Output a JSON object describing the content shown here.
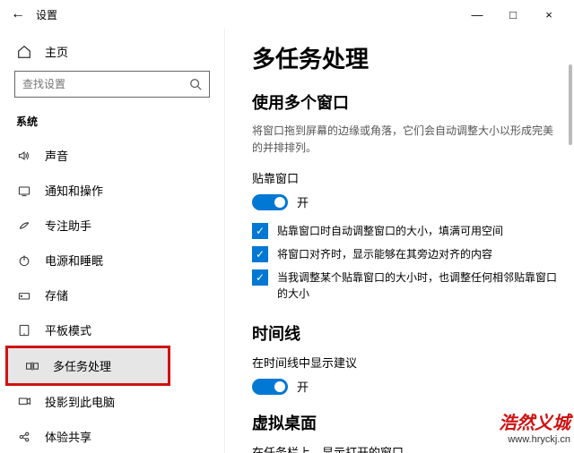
{
  "window": {
    "title": "设置",
    "min": "—",
    "max": "□",
    "close": "×"
  },
  "sidebar": {
    "home": "主页",
    "search_placeholder": "查找设置",
    "category": "系统",
    "items": [
      {
        "label": "声音"
      },
      {
        "label": "通知和操作"
      },
      {
        "label": "专注助手"
      },
      {
        "label": "电源和睡眠"
      },
      {
        "label": "存储"
      },
      {
        "label": "平板模式"
      },
      {
        "label": "多任务处理"
      },
      {
        "label": "投影到此电脑"
      },
      {
        "label": "体验共享"
      }
    ]
  },
  "main": {
    "heading": "多任务处理",
    "section1": {
      "title": "使用多个窗口",
      "desc": "将窗口拖到屏幕的边缘或角落，它们会自动调整大小以形成完美的并排排列。",
      "snap_label": "贴靠窗口",
      "on": "开",
      "checks": [
        "贴靠窗口时自动调整窗口的大小，填满可用空间",
        "将窗口对齐时，显示能够在其旁边对齐的内容",
        "当我调整某个贴靠窗口的大小时，也调整任何相邻贴靠窗口的大小"
      ]
    },
    "section2": {
      "title": "时间线",
      "sub": "在时间线中显示建议",
      "on": "开"
    },
    "section3": {
      "title": "虚拟桌面",
      "sub": "在任务栏上，显示打开的窗口"
    }
  },
  "watermark": {
    "big": "浩然义城",
    "url": "www.hryckj.cn"
  }
}
